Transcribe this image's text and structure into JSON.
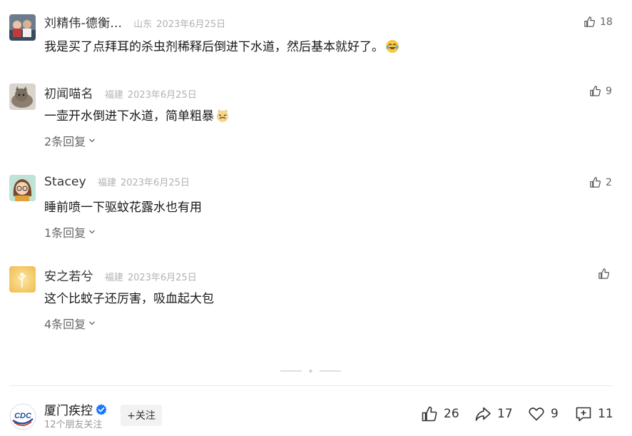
{
  "comments": [
    {
      "name": "刘精伟-德衡...",
      "location": "山东",
      "date": "2023年6月25日",
      "text": "我是买了点拜耳的杀虫剂稀释后倒进下水道，然后基本就好了。",
      "emoji": "laughing-tears-emoji",
      "likes": "18",
      "replies": ""
    },
    {
      "name": "初闻喵名",
      "location": "福建",
      "date": "2023年6月25日",
      "text": "一壶开水倒进下水道，简单粗暴",
      "emoji": "cat-emoji",
      "likes": "9",
      "replies": "2条回复"
    },
    {
      "name": "Stacey",
      "location": "福建",
      "date": "2023年6月25日",
      "text": "睡前喷一下驱蚊花露水也有用",
      "emoji": "",
      "likes": "2",
      "replies": "1条回复"
    },
    {
      "name": "安之若兮",
      "location": "福建",
      "date": "2023年6月25日",
      "text": "这个比蚊子还厉害，吸血起大包",
      "emoji": "",
      "likes": "",
      "replies": "4条回复"
    }
  ],
  "account": {
    "name": "厦门疾控",
    "subtitle": "12个朋友关注",
    "follow_label": "+关注",
    "logo_text": "CDC"
  },
  "actions": {
    "likes": "26",
    "shares": "17",
    "favorites": "9",
    "comments": "11"
  },
  "colors": {
    "text": "#191919",
    "meta": "#b2b2b2",
    "muted": "#666666",
    "verified": "#1677ff",
    "logo_blue": "#1b4f9c",
    "logo_red": "#d7261e"
  }
}
